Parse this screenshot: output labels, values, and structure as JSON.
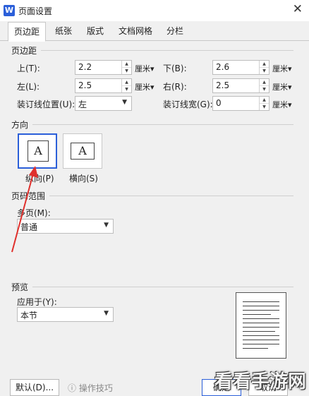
{
  "window": {
    "app_icon_letter": "W",
    "title": "页面设置"
  },
  "tabs": [
    "页边距",
    "纸张",
    "版式",
    "文档网格",
    "分栏"
  ],
  "margins": {
    "section_title": "页边距",
    "top_label": "上(T):",
    "top_value": "2.2",
    "bottom_label": "下(B):",
    "bottom_value": "2.6",
    "left_label": "左(L):",
    "left_value": "2.5",
    "right_label": "右(R):",
    "right_value": "2.5",
    "gutter_pos_label": "装订线位置(U):",
    "gutter_pos_value": "左",
    "gutter_width_label": "装订线宽(G):",
    "gutter_width_value": "0",
    "unit": "厘米"
  },
  "orientation": {
    "section_title": "方向",
    "portrait_label": "纵向(P)",
    "landscape_label": "横向(S)",
    "glyph": "A"
  },
  "page_range": {
    "section_title": "页码范围",
    "multi_label": "多页(M):",
    "multi_value": "普通"
  },
  "preview": {
    "section_title": "预览",
    "apply_label": "应用于(Y):",
    "apply_value": "本节"
  },
  "footer": {
    "default_button": "默认(D)...",
    "tips_link": "操作技巧",
    "ok_button": "确定",
    "cancel_button": "取消"
  },
  "watermark": "看看手游网",
  "colors": {
    "accent": "#2b5fd9",
    "annotation_arrow": "#e0302c"
  }
}
